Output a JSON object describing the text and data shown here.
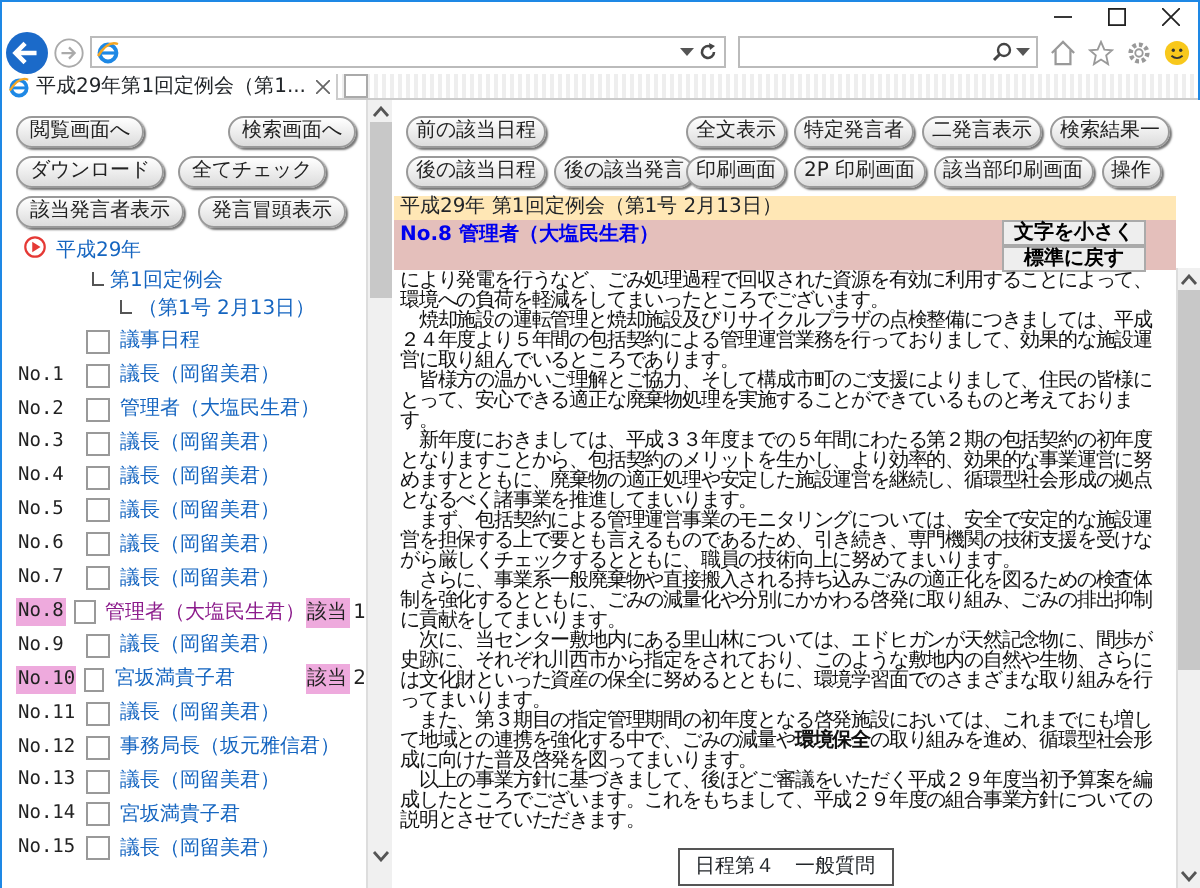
{
  "browser": {
    "tab": {
      "title": "平成29年第1回定例会（第1...",
      "selected": true
    }
  },
  "left_toolbar": [
    {
      "left": [
        "閲覧画面へ"
      ],
      "right": [
        "検索画面へ"
      ]
    },
    {
      "left": [
        "ダウンロード",
        "全てチェック"
      ]
    },
    {
      "left": [
        "該当発言者表示",
        "発言冒頭表示"
      ]
    }
  ],
  "tree": {
    "label": "平成29年",
    "expanded": true,
    "children": [
      {
        "label": "第1回定例会",
        "children": [
          {
            "label": "（第1号 2月13日）"
          }
        ]
      }
    ]
  },
  "agenda": {
    "label": "議事日程",
    "checked": false
  },
  "speeches": [
    {
      "number": "No.1",
      "speaker": "議長（岡留美君）",
      "checked": false,
      "highlighted": false,
      "current": false
    },
    {
      "number": "No.2",
      "speaker": "管理者（大塩民生君）",
      "checked": false,
      "highlighted": false,
      "current": false
    },
    {
      "number": "No.3",
      "speaker": "議長（岡留美君）",
      "checked": false,
      "highlighted": false,
      "current": false
    },
    {
      "number": "No.4",
      "speaker": "議長（岡留美君）",
      "checked": false,
      "highlighted": false,
      "current": false
    },
    {
      "number": "No.5",
      "speaker": "議長（岡留美君）",
      "checked": false,
      "highlighted": false,
      "current": false
    },
    {
      "number": "No.6",
      "speaker": "議長（岡留美君）",
      "checked": false,
      "highlighted": false,
      "current": false
    },
    {
      "number": "No.7",
      "speaker": "議長（岡留美君）",
      "checked": false,
      "highlighted": false,
      "current": false
    },
    {
      "number": "No.8",
      "speaker": "管理者（大塩民生君）",
      "checked": false,
      "highlighted": true,
      "current": true,
      "hit_label": "該当",
      "hit_number": "1"
    },
    {
      "number": "No.9",
      "speaker": "議長（岡留美君）",
      "checked": false,
      "highlighted": false,
      "current": false
    },
    {
      "number": "No.10",
      "speaker": "宮坂満貴子君",
      "checked": false,
      "highlighted": true,
      "current": false,
      "hit_label": "該当",
      "hit_number": "2"
    },
    {
      "number": "No.11",
      "speaker": "議長（岡留美君）",
      "checked": false,
      "highlighted": false,
      "current": false
    },
    {
      "number": "No.12",
      "speaker": "事務局長（坂元雅信君）",
      "checked": false,
      "highlighted": false,
      "current": false
    },
    {
      "number": "No.13",
      "speaker": "議長（岡留美君）",
      "checked": false,
      "highlighted": false,
      "current": false
    },
    {
      "number": "No.14",
      "speaker": "宮坂満貴子君",
      "checked": false,
      "highlighted": false,
      "current": false
    },
    {
      "number": "No.15",
      "speaker": "議長（岡留美君）",
      "checked": false,
      "highlighted": false,
      "current": false
    }
  ],
  "right_toolbar": [
    {
      "left": [
        "前の該当日程"
      ],
      "right": [
        "全文表示",
        "特定発言者",
        "二発言表示",
        "検索結果一"
      ]
    },
    {
      "left": [
        "後の該当日程",
        "後の該当発言"
      ],
      "right": [
        "印刷画面",
        "2P 印刷画面",
        "該当部印刷画面",
        "操作"
      ]
    }
  ],
  "document": {
    "session": "平成29年 第1回定例会（第1号 2月13日）",
    "speaker": "No.8 管理者（大塩民生君）",
    "font_buttons": [
      "文字を小さく",
      "標準に戻す"
    ],
    "paragraphs": [
      "により発電を行うなど、ごみ処理過程で回収された資源を有効に利用することによって、環境への負荷を軽減をしてまいったところでございます。",
      "　焼却施設の運転管理と焼却施設及びリサイクルプラザの点検整備につきましては、平成２４年度より５年間の包括契約による管理運営業務を行っておりまして、効果的な施設運営に取り組んでいるところであります。",
      "　皆様方の温かいご理解とご協力、そして構成市町のご支援によりまして、住民の皆様にとって、安心できる適正な廃棄物処理を実施することができているものと考えております。",
      "　新年度におきましては、平成３３年度までの５年間にわたる第２期の包括契約の初年度となりますことから、包括契約のメリットを生かし、より効率的、効果的な事業運営に努めますとともに、廃棄物の適正処理や安定した施設運営を継続し、循環型社会形成の拠点となるべく諸事業を推進してまいります。",
      "　まず、包括契約による管理運営事業のモニタリングについては、安全で安定的な施設運営を担保する上で要とも言えるものであるため、引き続き、専門機関の技術支援を受けながら厳しくチェックするとともに、職員の技術向上に努めてまいります。",
      "　さらに、事業系一般廃棄物や直接搬入される持ち込みごみの適正化を図るための検査体制を強化するとともに、ごみの減量化や分別にかかわる啓発に取り組み、ごみの排出抑制に貢献をしてまいります。",
      "　次に、当センター敷地内にある里山林については、エドヒガンが天然記念物に、間歩が史跡に、それぞれ川西市から指定をされており、このような敷地内の自然や生物、さらには文化財といった資産の保全に努めるとともに、環境学習面でのさまざまな取り組みを行ってまいります。",
      "　また、第３期目の指定管理期間の初年度となる啓発施設においては、これまでにも増して地域との連携を強化する中で、ごみの減量や**環境保全**の取り組みを進め、循環型社会形成に向けた普及啓発を図ってまいります。",
      "　以上の事業方針に基づきまして、後ほどご審議をいただく平成２９年度当初予算案を編成したところでございます。これをもちまして、平成２９年度の組合事業方針についての説明とさせていただきます。"
    ],
    "next_item": "日程第４　一般質問"
  }
}
